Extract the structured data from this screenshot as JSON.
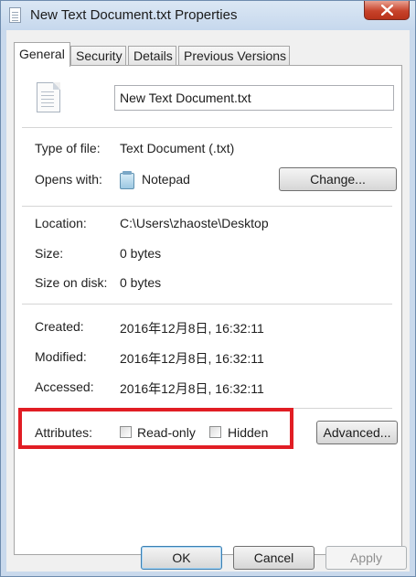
{
  "window": {
    "title": "New Text Document.txt Properties",
    "close_symbol": "✕"
  },
  "tabs": [
    {
      "label": "General",
      "active": true
    },
    {
      "label": "Security",
      "active": false
    },
    {
      "label": "Details",
      "active": false
    },
    {
      "label": "Previous Versions",
      "active": false
    }
  ],
  "file": {
    "name": "New Text Document.txt",
    "icon": "text-file-icon"
  },
  "type_section": {
    "type_label": "Type of file:",
    "type_value": "Text Document (.txt)",
    "opens_label": "Opens with:",
    "opens_value": "Notepad",
    "opens_icon": "notepad-icon",
    "change_button": "Change..."
  },
  "location_section": {
    "location_label": "Location:",
    "location_value": "C:\\Users\\zhaoste\\Desktop",
    "size_label": "Size:",
    "size_value": "0 bytes",
    "size_on_disk_label": "Size on disk:",
    "size_on_disk_value": "0 bytes"
  },
  "dates_section": {
    "created_label": "Created:",
    "created_value": "2016年12月8日, 16:32:11",
    "modified_label": "Modified:",
    "modified_value": "2016年12月8日, 16:32:11",
    "accessed_label": "Accessed:",
    "accessed_value": "2016年12月8日, 16:32:11"
  },
  "attributes": {
    "label": "Attributes:",
    "read_only_label": "Read-only",
    "read_only_checked": false,
    "hidden_label": "Hidden",
    "hidden_checked": false,
    "advanced_button": "Advanced...",
    "highlight_color": "#e11d24"
  },
  "footer": {
    "ok": "OK",
    "cancel": "Cancel",
    "apply": "Apply"
  }
}
